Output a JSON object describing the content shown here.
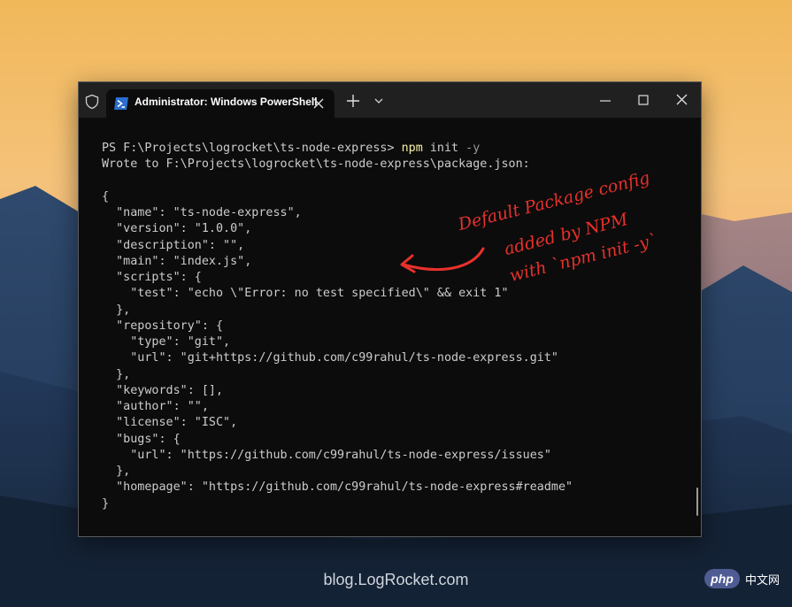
{
  "window": {
    "tab_title": "Administrator: Windows PowerShell"
  },
  "terminal": {
    "prompt_prefix": "PS F:\\Projects\\logrocket\\ts-node-express> ",
    "command": "npm",
    "command_args": " init ",
    "command_flag": "-y",
    "output_lines": [
      "Wrote to F:\\Projects\\logrocket\\ts-node-express\\package.json:",
      "",
      "{",
      "  \"name\": \"ts-node-express\",",
      "  \"version\": \"1.0.0\",",
      "  \"description\": \"\",",
      "  \"main\": \"index.js\",",
      "  \"scripts\": {",
      "    \"test\": \"echo \\\"Error: no test specified\\\" && exit 1\"",
      "  },",
      "  \"repository\": {",
      "    \"type\": \"git\",",
      "    \"url\": \"git+https://github.com/c99rahul/ts-node-express.git\"",
      "  },",
      "  \"keywords\": [],",
      "  \"author\": \"\",",
      "  \"license\": \"ISC\",",
      "  \"bugs\": {",
      "    \"url\": \"https://github.com/c99rahul/ts-node-express/issues\"",
      "  },",
      "  \"homepage\": \"https://github.com/c99rahul/ts-node-express#readme\"",
      "}"
    ]
  },
  "annotation": {
    "lines": [
      "Default Package config",
      "added by NPM",
      "with `npm init -y`"
    ],
    "color": "#e8312c"
  },
  "watermark": {
    "text": "blog.LogRocket.com",
    "badge": "php",
    "badge_cn": "中文网"
  },
  "colors": {
    "terminal_bg": "#0c0c0c",
    "titlebar_bg": "#202020",
    "command_yellow": "#f9f1a5",
    "text": "#cccccc"
  }
}
